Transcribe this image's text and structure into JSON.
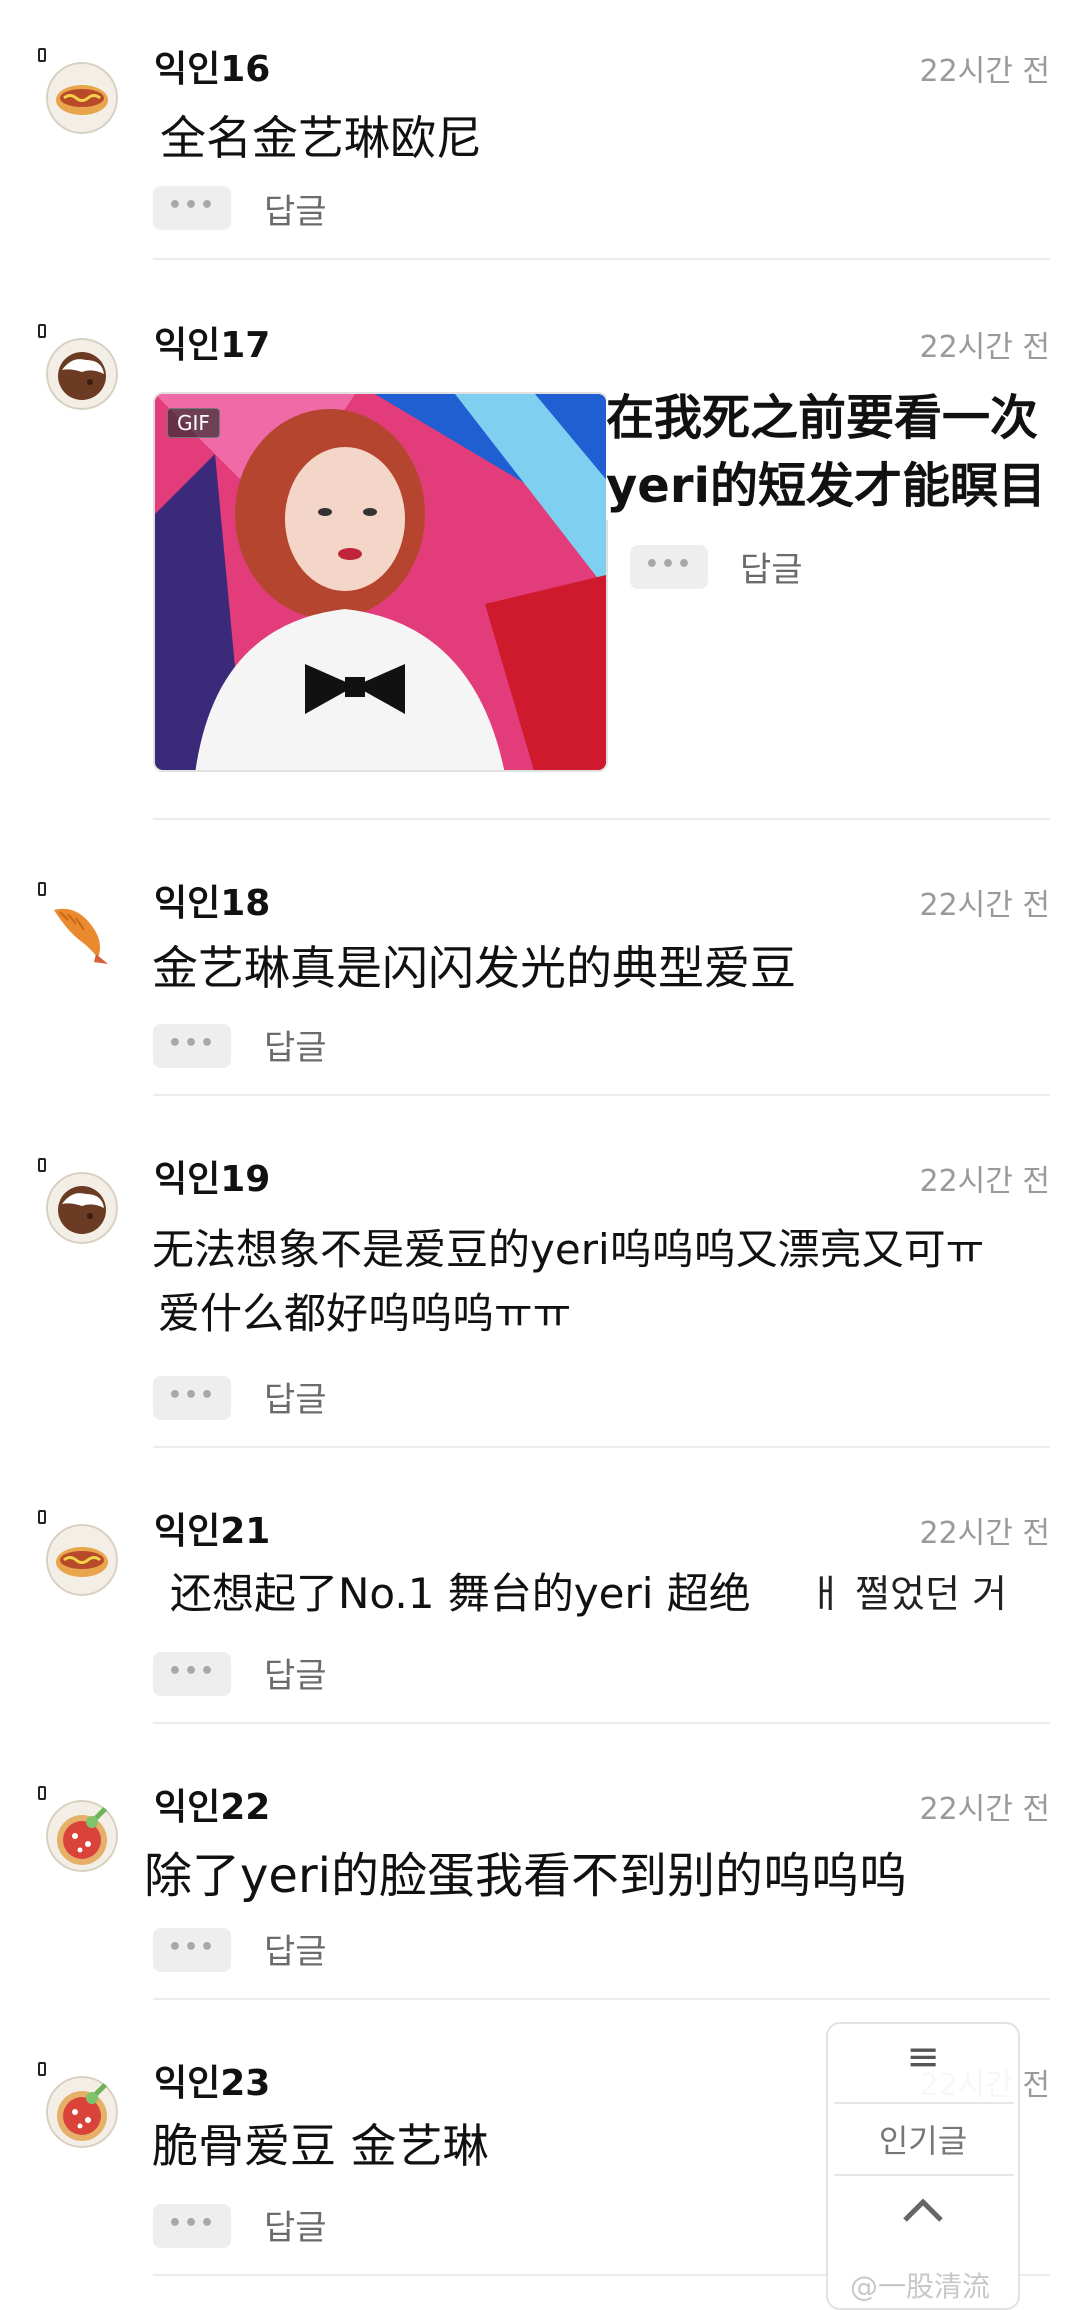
{
  "comments": [
    {
      "nick": "익인16",
      "time": "22시간 전",
      "text": "全名金艺琳欧尼",
      "more": "•••",
      "reply": "답글"
    },
    {
      "nick": "익인17",
      "time": "22시간 전",
      "text_line1": "在我死之前要看一次",
      "text_line2": "yeri的短发才能瞑目",
      "gif_badge": "GIF",
      "more": "•••",
      "reply": "답글"
    },
    {
      "nick": "익인18",
      "time": "22시간 전",
      "text": "金艺琳真是闪闪发光的典型爱豆",
      "more": "•••",
      "reply": "답글"
    },
    {
      "nick": "익인19",
      "time": "22시간 전",
      "text_line1": "无法想象不是爱豆的yeri呜呜呜又漂亮又可ㅠ",
      "text_line2": "爱什么都好呜呜呜ㅠㅠ",
      "more": "•••",
      "reply": "답글"
    },
    {
      "nick": "익인21",
      "time": "22시간 전",
      "text": "还想起了No.1 舞台的yeri 超绝",
      "text_tail": "ㅐ 쩔었던 거",
      "more": "•••",
      "reply": "답글"
    },
    {
      "nick": "익인22",
      "time": "22시간 전",
      "text": "除了yeri的脸蛋我看不到别的呜呜呜",
      "more": "•••",
      "reply": "답글"
    },
    {
      "nick": "익인23",
      "time": "22시간 전",
      "text": "脆骨爱豆 金艺琳",
      "more": "•••",
      "reply": "답글"
    }
  ],
  "float_menu": {
    "menu_icon": "≡",
    "popular": "인기글",
    "up_icon": "^"
  },
  "watermark": "@一股清流",
  "colors": {
    "time": "#9a9a9a",
    "reply": "#6b6b6b",
    "more_bg": "#eeeeee",
    "divider": "#ececec"
  },
  "icons": [
    "hotdog-avatar-icon",
    "rice-avatar-icon",
    "shrimp-avatar-icon",
    "pizza-avatar-icon",
    "menu-icon",
    "chevron-up-icon"
  ]
}
